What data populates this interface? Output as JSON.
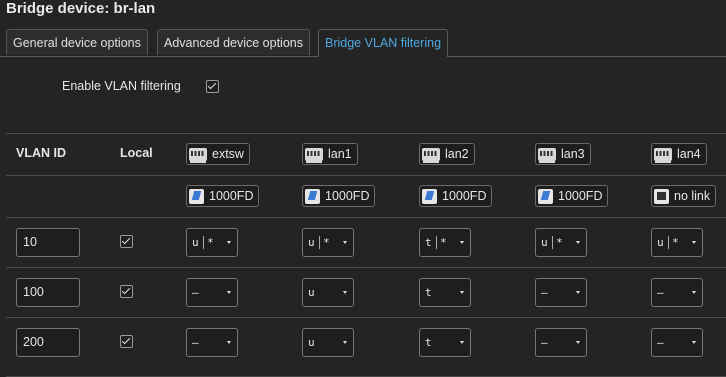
{
  "title": "Bridge device: br-lan",
  "tabs": [
    {
      "label": "General device options"
    },
    {
      "label": "Advanced device options"
    },
    {
      "label": "Bridge VLAN filtering"
    }
  ],
  "enable_vlan_filtering": {
    "label": "Enable VLAN filtering",
    "checked": true
  },
  "table": {
    "headers": {
      "vlan_id": "VLAN ID",
      "local": "Local"
    },
    "ports": [
      {
        "name": "extsw",
        "speed": "1000FD",
        "icon": "ethernet-port-icon",
        "speed_icon": "link-up-icon"
      },
      {
        "name": "lan1",
        "speed": "1000FD",
        "icon": "ethernet-port-icon",
        "speed_icon": "link-up-icon"
      },
      {
        "name": "lan2",
        "speed": "1000FD",
        "icon": "ethernet-port-icon",
        "speed_icon": "link-up-icon"
      },
      {
        "name": "lan3",
        "speed": "1000FD",
        "icon": "ethernet-port-icon",
        "speed_icon": "link-up-icon"
      },
      {
        "name": "lan4",
        "speed": "no link",
        "icon": "ethernet-port-icon",
        "speed_icon": "no-link-icon"
      }
    ],
    "rows": [
      {
        "vlan_id": "10",
        "local": true,
        "cells": [
          {
            "mode": "u",
            "pvid": "*"
          },
          {
            "mode": "u",
            "pvid": "*"
          },
          {
            "mode": "t",
            "pvid": "*"
          },
          {
            "mode": "u",
            "pvid": "*"
          },
          {
            "mode": "u",
            "pvid": "*"
          }
        ]
      },
      {
        "vlan_id": "100",
        "local": true,
        "cells": [
          {
            "mode": "–",
            "pvid": ""
          },
          {
            "mode": "u",
            "pvid": ""
          },
          {
            "mode": "t",
            "pvid": ""
          },
          {
            "mode": "–",
            "pvid": ""
          },
          {
            "mode": "–",
            "pvid": ""
          }
        ]
      },
      {
        "vlan_id": "200",
        "local": true,
        "cells": [
          {
            "mode": "–",
            "pvid": ""
          },
          {
            "mode": "u",
            "pvid": ""
          },
          {
            "mode": "t",
            "pvid": ""
          },
          {
            "mode": "–",
            "pvid": ""
          },
          {
            "mode": "–",
            "pvid": ""
          }
        ]
      }
    ]
  },
  "colors": {
    "background": "#242424",
    "accent": "#4ea8de",
    "text": "#e6e6e6"
  }
}
